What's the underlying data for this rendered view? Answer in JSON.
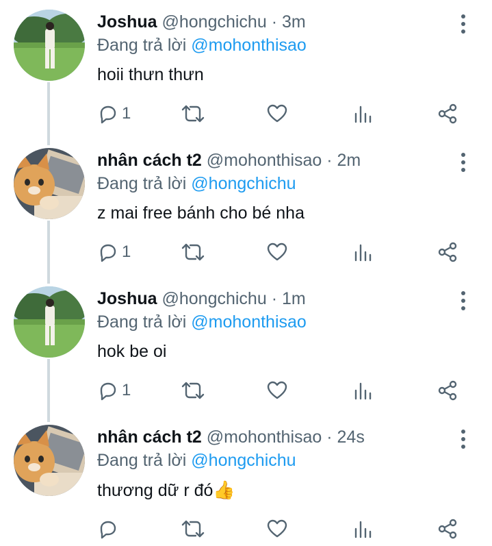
{
  "tweets": [
    {
      "name": "Joshua",
      "handle": "@hongchichu",
      "time": "3m",
      "reply_prefix": "Đang trả lời",
      "reply_to": "@mohonthisao",
      "text": "hoii thưn thưn",
      "reply_count": "1",
      "avatar": "person-in-field"
    },
    {
      "name": "nhân cách t2",
      "handle": "@mohonthisao",
      "time": "2m",
      "reply_prefix": "Đang trả lời",
      "reply_to": "@hongchichu",
      "text": "z mai free bánh cho bé nha",
      "reply_count": "1",
      "avatar": "cat-on-laptop"
    },
    {
      "name": "Joshua",
      "handle": "@hongchichu",
      "time": "1m",
      "reply_prefix": "Đang trả lời",
      "reply_to": "@mohonthisao",
      "text": "hok be oi",
      "reply_count": "1",
      "avatar": "person-in-field"
    },
    {
      "name": "nhân cách t2",
      "handle": "@mohonthisao",
      "time": "24s",
      "reply_prefix": "Đang trả lời",
      "reply_to": "@hongchichu",
      "text": "thương dữ r đó",
      "emoji": "👍",
      "reply_count": "",
      "avatar": "cat-on-laptop"
    }
  ],
  "separator": " · ",
  "colors": {
    "text": "#0f1419",
    "secondary": "#536471",
    "link": "#1d9bf0",
    "thread_line": "#cfd9de"
  }
}
